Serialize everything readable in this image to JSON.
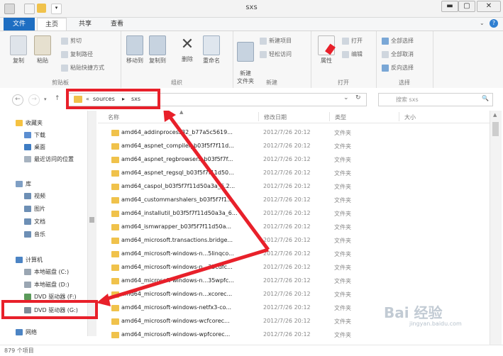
{
  "window": {
    "title": "sxs",
    "min_label": "▬",
    "max_label": "▢",
    "close_label": "✕",
    "help_label": "?"
  },
  "ribbon_tabs": [
    {
      "label": "文件"
    },
    {
      "label": "主页"
    },
    {
      "label": "共享"
    },
    {
      "label": "查看"
    }
  ],
  "ribbon": {
    "clipboard": {
      "copy": "复制",
      "paste": "粘贴",
      "cut": "剪切",
      "copy_path": "复制路径",
      "paste_shortcut": "粘贴快捷方式",
      "label": "剪贴板"
    },
    "organize": {
      "move_to": "移动到",
      "copy_to": "复制到",
      "delete": "删除",
      "rename": "重命名",
      "label": "组织"
    },
    "new": {
      "new_folder": "新建\n文件夹",
      "new_item": "新建项目",
      "easy_access": "轻松访问",
      "label": "新建"
    },
    "open": {
      "properties": "属性",
      "open": "打开",
      "edit": "编辑",
      "label": "打开"
    },
    "select": {
      "select_all": "全部选择",
      "select_none": "全部取消",
      "invert": "反向选择",
      "label": "选择"
    }
  },
  "address": {
    "crumbs": [
      "«",
      "sources",
      "▸",
      "sxs"
    ],
    "dropdown": "⌄",
    "refresh": "↻"
  },
  "search": {
    "placeholder": "搜索 sxs",
    "icon": "🔍"
  },
  "nav": {
    "favorites": "收藏夹",
    "downloads": "下载",
    "desktop": "桌面",
    "recent": "最近访问的位置",
    "libraries": "库",
    "videos": "视频",
    "pictures": "图片",
    "documents": "文档",
    "music": "音乐",
    "computer": "计算机",
    "local_c": "本地磁盘 (C:)",
    "local_d": "本地磁盘 (D:)",
    "dvd_f": "DVD 驱动器 (F:)",
    "dvd_g": "DVD 驱动器 (G:)",
    "network": "网络"
  },
  "columns": {
    "name": "名称",
    "date": "修改日期",
    "type": "类型",
    "size": "大小"
  },
  "files": [
    {
      "name": "amd64_addinprocess32_b77a5c5619...",
      "date": "2012/7/26 20:12",
      "type": "文件夹"
    },
    {
      "name": "amd64_aspnet_compiler_b03f5f7f11d...",
      "date": "2012/7/26 20:12",
      "type": "文件夹"
    },
    {
      "name": "amd64_aspnet_regbrowsers_b03f5f7f...",
      "date": "2012/7/26 20:12",
      "type": "文件夹"
    },
    {
      "name": "amd64_aspnet_regsql_b03f5f7f11d50...",
      "date": "2012/7/26 20:12",
      "type": "文件夹"
    },
    {
      "name": "amd64_caspol_b03f5f7f11d50a3a_6.2...",
      "date": "2012/7/26 20:12",
      "type": "文件夹"
    },
    {
      "name": "amd64_custommarshalers_b03f5f7f1...",
      "date": "2012/7/26 20:12",
      "type": "文件夹"
    },
    {
      "name": "amd64_installutil_b03f5f7f11d50a3a_6...",
      "date": "2012/7/26 20:12",
      "type": "文件夹"
    },
    {
      "name": "amd64_ismwrapper_b03f5f7f11d50a...",
      "date": "2012/7/26 20:12",
      "type": "文件夹"
    },
    {
      "name": "amd64_microsoft.transactions.bridge...",
      "date": "2012/7/26 20:12",
      "type": "文件夹"
    },
    {
      "name": "amd64_microsoft-windows-n...5linqco...",
      "date": "2012/7/26 20:12",
      "type": "文件夹"
    },
    {
      "name": "amd64_microsoft-windows-n...35cdfc...",
      "date": "2012/7/26 20:12",
      "type": "文件夹"
    },
    {
      "name": "amd64_microsoft-windows-n...35wpfc...",
      "date": "2012/7/26 20:12",
      "type": "文件夹"
    },
    {
      "name": "amd64_microsoft-windows-n...xcorec...",
      "date": "2012/7/26 20:12",
      "type": "文件夹"
    },
    {
      "name": "amd64_microsoft-windows-netfx3-co...",
      "date": "2012/7/26 20:12",
      "type": "文件夹"
    },
    {
      "name": "amd64_microsoft-windows-wcfcorec...",
      "date": "2012/7/26 20:12",
      "type": "文件夹"
    },
    {
      "name": "amd64_microsoft-windows-wpfcorec...",
      "date": "2012/7/26 20:12",
      "type": "文件夹"
    },
    {
      "name": "amd64_msbuild_b03f5f7f11d50a3a_6...",
      "date": "2012/7/26 20:12",
      "type": "文件夹"
    }
  ],
  "status": {
    "count": "879 个项目"
  },
  "watermark": {
    "line1": "Bai 经验",
    "line2": "jingyan.baidu.com"
  },
  "colors": {
    "file_tab": "#1e6ec2",
    "folder": "#f0c24b",
    "highlight": "#e8202a"
  }
}
